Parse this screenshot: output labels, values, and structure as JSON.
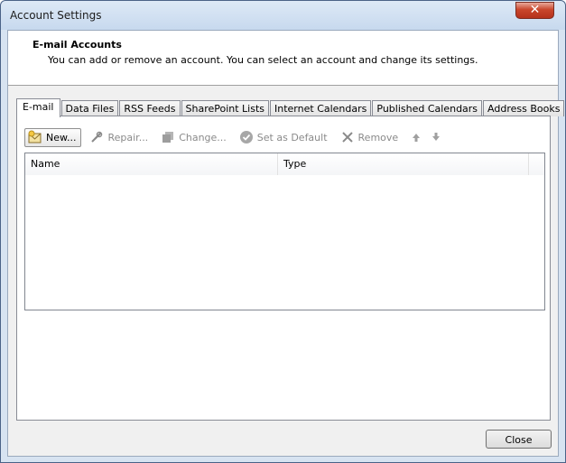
{
  "window": {
    "title": "Account Settings",
    "close_glyph": "✕"
  },
  "header": {
    "title": "E-mail Accounts",
    "description": "You can add or remove an account. You can select an account and change its settings."
  },
  "tabs": [
    {
      "label": "E-mail",
      "active": true
    },
    {
      "label": "Data Files",
      "active": false
    },
    {
      "label": "RSS Feeds",
      "active": false
    },
    {
      "label": "SharePoint Lists",
      "active": false
    },
    {
      "label": "Internet Calendars",
      "active": false
    },
    {
      "label": "Published Calendars",
      "active": false
    },
    {
      "label": "Address Books",
      "active": false
    }
  ],
  "toolbar": {
    "new_label": "New...",
    "repair_label": "Repair...",
    "change_label": "Change...",
    "set_default_label": "Set as Default",
    "remove_label": "Remove"
  },
  "grid": {
    "columns": [
      "Name",
      "Type"
    ]
  },
  "footer": {
    "close_label": "Close"
  },
  "icons": {
    "new": "mail-new-icon",
    "repair": "tools-icon",
    "change": "copy-icon",
    "set_default": "check-circle-icon",
    "remove": "x-icon",
    "up": "arrow-up-icon",
    "down": "arrow-down-icon"
  }
}
